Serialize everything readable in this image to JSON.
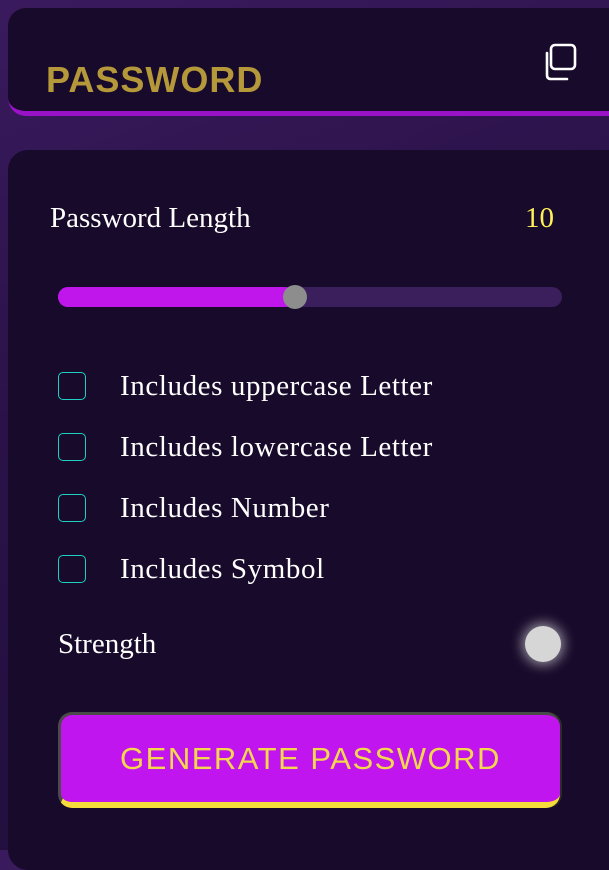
{
  "display": {
    "password_text": "PASSWORD",
    "copy_icon": "copy-icon"
  },
  "length": {
    "label": "Password Length",
    "value": "10",
    "slider_fill_fraction": 0.47
  },
  "options": [
    {
      "label": "Includes uppercase Letter",
      "checked": false
    },
    {
      "label": "Includes lowercase Letter",
      "checked": false
    },
    {
      "label": "Includes Number",
      "checked": false
    },
    {
      "label": "Includes Symbol",
      "checked": false
    }
  ],
  "strength": {
    "label": "Strength",
    "indicator_color": "#d6d6d6"
  },
  "generate": {
    "label": "GENERATE PASSWORD"
  },
  "colors": {
    "accent": "#c016ec",
    "highlight": "#fff05a",
    "checkbox_border": "#1ecfc4",
    "placeholder_text": "#b5983a"
  }
}
